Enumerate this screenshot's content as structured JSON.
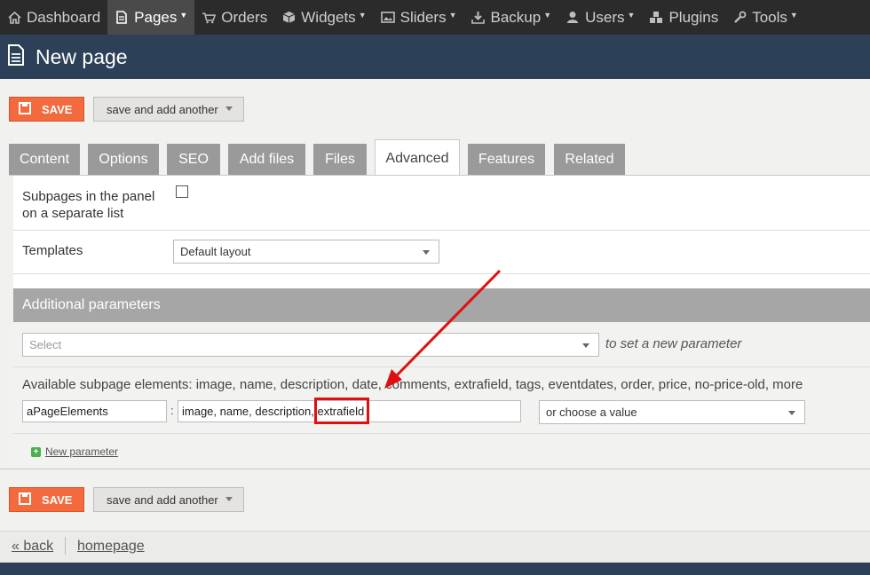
{
  "nav": {
    "items": [
      {
        "label": "Dashboard",
        "icon": "home-icon",
        "caret": false,
        "active": false
      },
      {
        "label": "Pages",
        "icon": "document-icon",
        "caret": true,
        "active": true
      },
      {
        "label": "Orders",
        "icon": "cart-icon",
        "caret": false,
        "active": false
      },
      {
        "label": "Widgets",
        "icon": "cube-icon",
        "caret": true,
        "active": false
      },
      {
        "label": "Sliders",
        "icon": "image-icon",
        "caret": true,
        "active": false
      },
      {
        "label": "Backup",
        "icon": "download-icon",
        "caret": true,
        "active": false
      },
      {
        "label": "Users",
        "icon": "user-icon",
        "caret": true,
        "active": false
      },
      {
        "label": "Plugins",
        "icon": "cubes-icon",
        "caret": false,
        "active": false
      },
      {
        "label": "Tools",
        "icon": "wrench-icon",
        "caret": true,
        "active": false
      }
    ]
  },
  "header": {
    "title": "New page"
  },
  "toolbar": {
    "save_label": "SAVE",
    "save_another_label": "save and add another"
  },
  "tabs": [
    "Content",
    "Options",
    "SEO",
    "Add files",
    "Files",
    "Advanced",
    "Features",
    "Related"
  ],
  "active_tab": "Advanced",
  "form": {
    "subpages_label_line1": "Subpages in the panel",
    "subpages_label_line2": "on a separate list",
    "templates_label": "Templates",
    "templates_value": "Default layout"
  },
  "additional": {
    "title": "Additional parameters",
    "select_placeholder": "Select",
    "hint": "to set a new parameter",
    "elements_text": "Available subpage elements: image, name, description, date, comments, extrafield, tags, eventdates, order, price, no-price-old, more",
    "param_name": "aPageElements",
    "param_separator": ":",
    "param_value": "image, name, description, extrafield",
    "choose_value": "or choose a value",
    "new_param_label": "New parameter"
  },
  "footer": {
    "back_label": "« back",
    "homepage_label": "homepage"
  },
  "colors": {
    "save": "#f26a3d",
    "header": "#2c4157",
    "annotation": "#e01010"
  }
}
